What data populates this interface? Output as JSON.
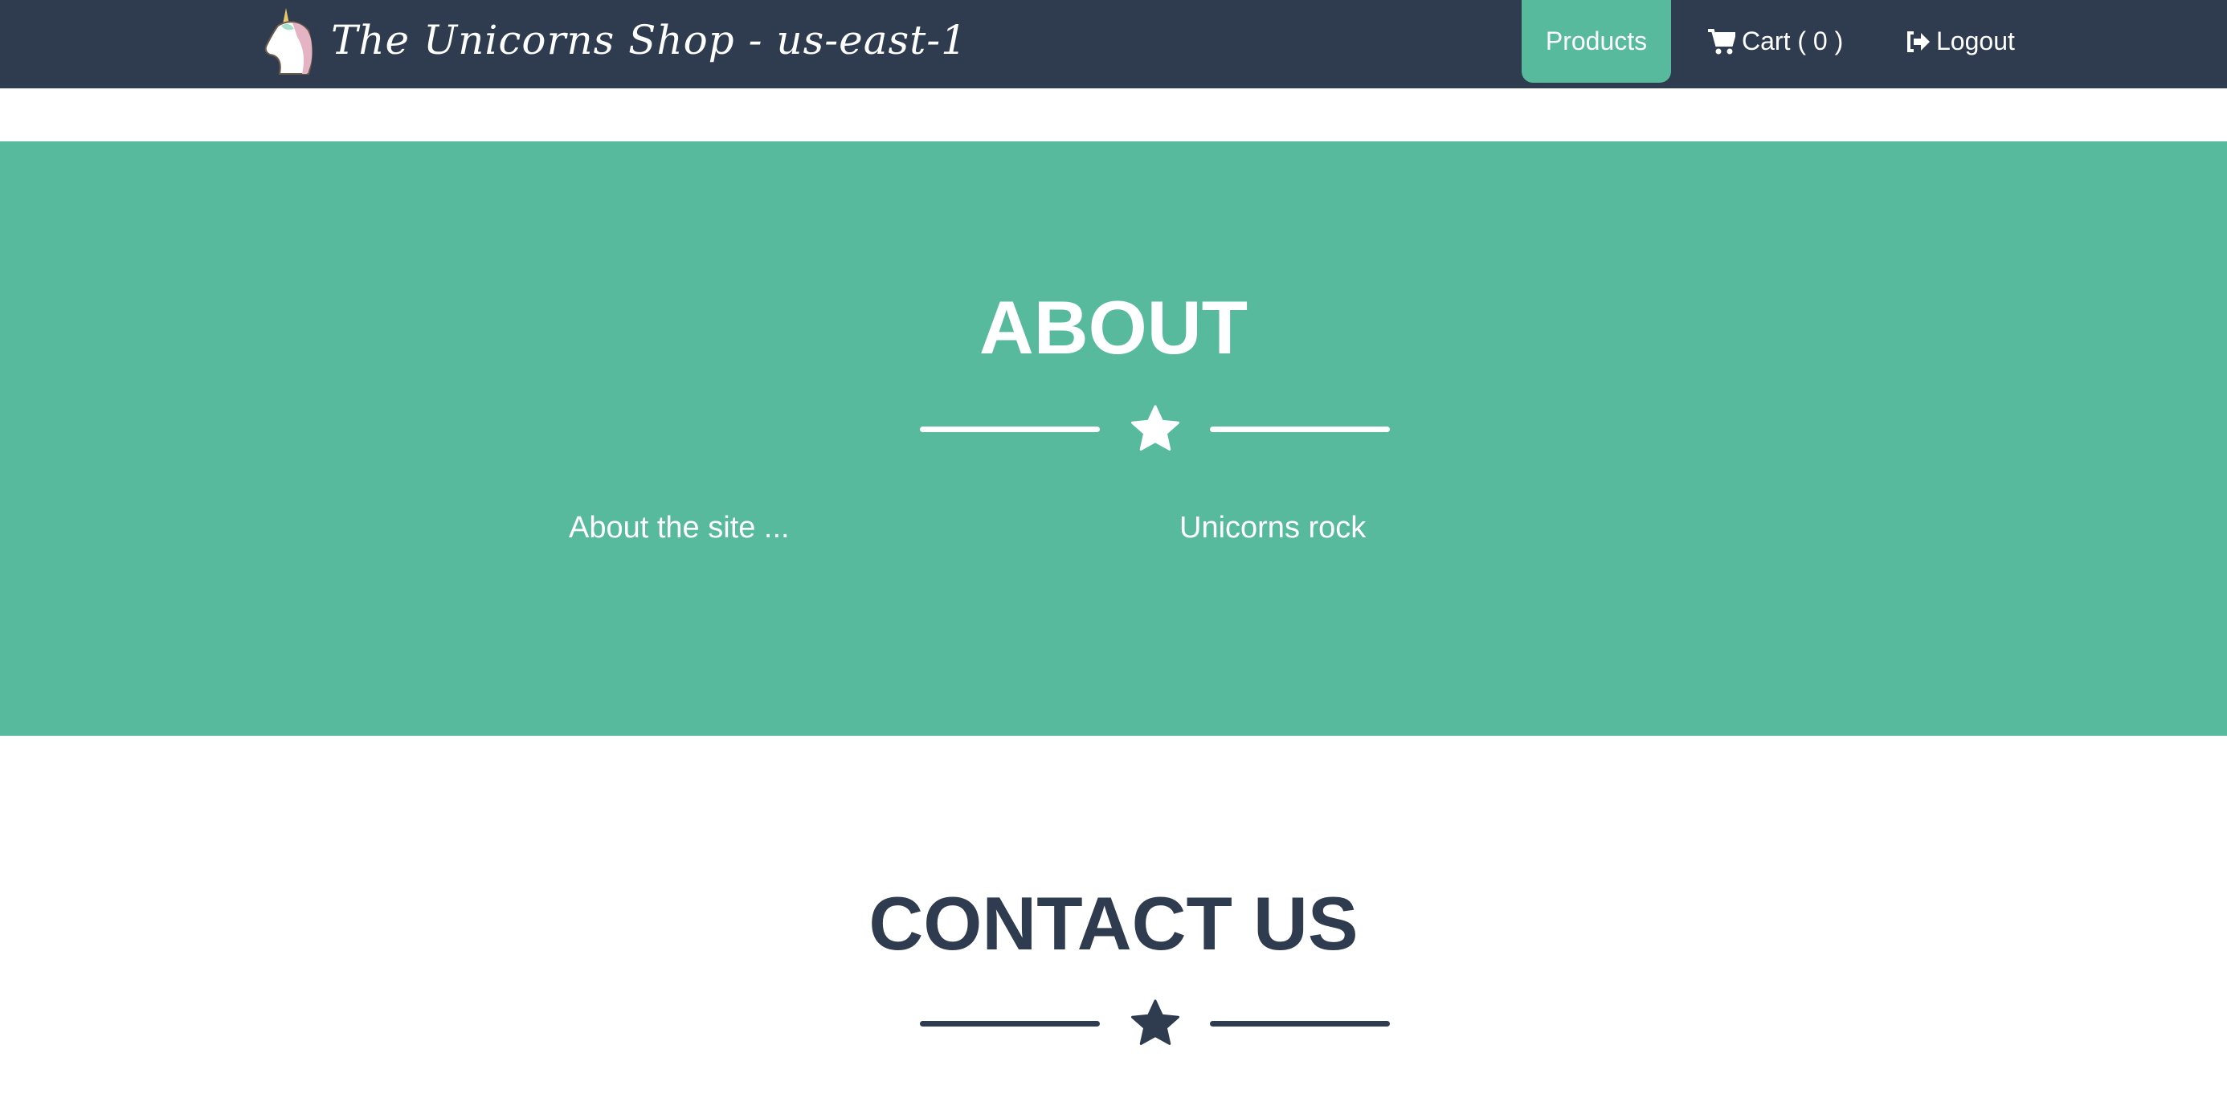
{
  "navbar": {
    "brand": "The Unicorns Shop - us-east-1",
    "products": "Products",
    "cart": "Cart ( 0 )",
    "logout": "Logout"
  },
  "about": {
    "title": "ABOUT",
    "left_text": "About the site ...",
    "right_text": "Unicorns rock"
  },
  "contact": {
    "title": "CONTACT US"
  },
  "colors": {
    "navbar": "#2f3c50",
    "accent": "#57ba9d"
  }
}
